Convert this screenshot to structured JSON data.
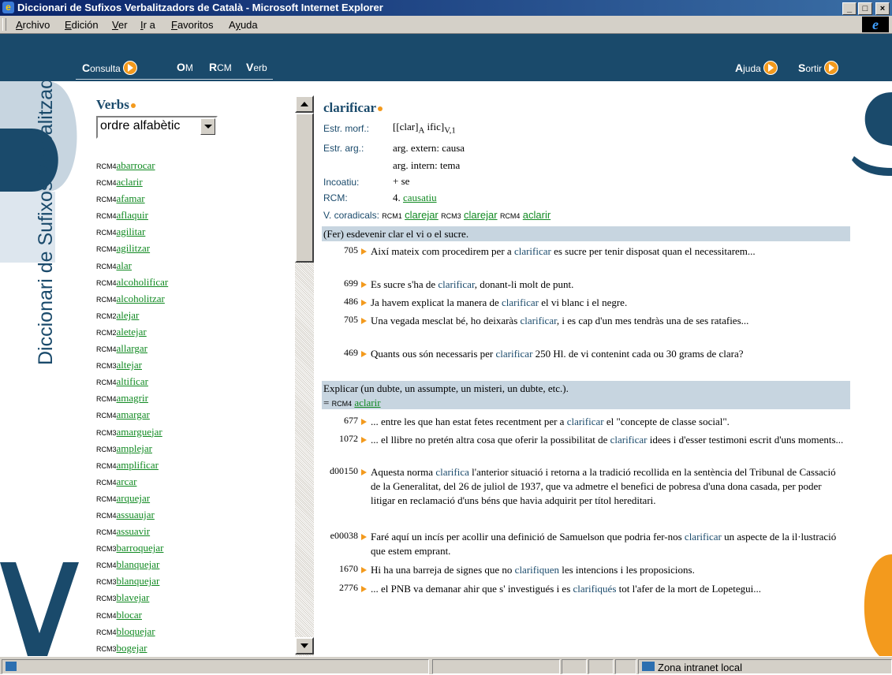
{
  "window": {
    "title": "Diccionari de Sufixos Verbalitzadors de Català - Microsoft Internet Explorer",
    "controls": {
      "minimize": "_",
      "maximize": "□",
      "close": "×"
    }
  },
  "menubar": {
    "items": [
      "Archivo",
      "Edición",
      "Ver",
      "Ir a",
      "Favoritos",
      "Ayuda"
    ]
  },
  "nav": {
    "consulta": {
      "initial": "C",
      "rest": "onsulta"
    },
    "om": {
      "initial": "O",
      "rest": "M"
    },
    "rcm": {
      "initial": "R",
      "rest": "CM"
    },
    "verb": {
      "initial": "V",
      "rest": "erb"
    },
    "ajuda": {
      "initial": "A",
      "rest": "juda"
    },
    "sortir": {
      "initial": "S",
      "rest": "ortir"
    }
  },
  "branding": {
    "vertical_title": "Diccionari de Sufixos Verbalitzadors del Català",
    "colors": {
      "navy": "#1a4a6b",
      "orange": "#f39a1d",
      "link_green": "#118a22",
      "band": "#c7d5e0"
    }
  },
  "sidebar": {
    "title": "Verbs",
    "order_select": "ordre alfabètic",
    "verbs": [
      {
        "rcm": "RCM4",
        "verb": "abarrocar"
      },
      {
        "rcm": "RCM4",
        "verb": "aclarir"
      },
      {
        "rcm": "RCM4",
        "verb": "afamar"
      },
      {
        "rcm": "RCM4",
        "verb": "aflaquir"
      },
      {
        "rcm": "RCM4",
        "verb": "agilitar"
      },
      {
        "rcm": "RCM4",
        "verb": "agilitzar"
      },
      {
        "rcm": "RCM4",
        "verb": "alar"
      },
      {
        "rcm": "RCM4",
        "verb": "alcoholificar"
      },
      {
        "rcm": "RCM4",
        "verb": "alcoholitzar"
      },
      {
        "rcm": "RCM2",
        "verb": "alejar"
      },
      {
        "rcm": "RCM2",
        "verb": "aletejar"
      },
      {
        "rcm": "RCM4",
        "verb": "allargar"
      },
      {
        "rcm": "RCM3",
        "verb": "altejar"
      },
      {
        "rcm": "RCM4",
        "verb": "altificar"
      },
      {
        "rcm": "RCM4",
        "verb": "amagrir"
      },
      {
        "rcm": "RCM4",
        "verb": "amargar"
      },
      {
        "rcm": "RCM3",
        "verb": "amarguejar"
      },
      {
        "rcm": "RCM3",
        "verb": "amplejar"
      },
      {
        "rcm": "RCM4",
        "verb": "amplificar"
      },
      {
        "rcm": "RCM4",
        "verb": "arcar"
      },
      {
        "rcm": "RCM4",
        "verb": "arquejar"
      },
      {
        "rcm": "RCM4",
        "verb": "assuaujar"
      },
      {
        "rcm": "RCM4",
        "verb": "assuavir"
      },
      {
        "rcm": "RCM3",
        "verb": "barroquejar"
      },
      {
        "rcm": "RCM4",
        "verb": "blanquejar"
      },
      {
        "rcm": "RCM3",
        "verb": "blanquejar"
      },
      {
        "rcm": "RCM3",
        "verb": "blavejar"
      },
      {
        "rcm": "RCM4",
        "verb": "blocar"
      },
      {
        "rcm": "RCM4",
        "verb": "bloquejar"
      },
      {
        "rcm": "RCM3",
        "verb": "bogejar"
      }
    ]
  },
  "entry": {
    "headword": "clarificar",
    "estr_morf_label": "Estr. morf.:",
    "estr_morf": {
      "open": "[[clar]",
      "sub_a": "A",
      "mid": " ific]",
      "sub_v": "V,1"
    },
    "estr_arg_label": "Estr. arg.:",
    "arg_extern": "arg. extern: causa",
    "arg_intern": "arg. intern: tema",
    "incoatiu_label": "Incoatiu:",
    "incoatiu": "+ se",
    "rcm_label": "RCM:",
    "rcm_num": "4.",
    "rcm_value": "causatiu",
    "coradicals_label": "V. coradicals:",
    "coradicals": [
      {
        "rcm": "RCM1",
        "verb": "clarejar"
      },
      {
        "rcm": "RCM3",
        "verb": "clarejar"
      },
      {
        "rcm": "RCM4",
        "verb": "aclarir"
      }
    ],
    "senses": [
      {
        "definition": "(Fer) esdevenir clar el vi o el sucre.",
        "examples": [
          {
            "num": "705",
            "pre": "Així mateix com procedirem per a ",
            "kw": "clarificar",
            "post": " es sucre per tenir disposat quan el necessitarem..."
          },
          {
            "num": "699",
            "pre": "Es sucre s'ha de ",
            "kw": "clarificar",
            "post": ", donant-li molt de punt."
          },
          {
            "num": "486",
            "pre": "Ja havem explicat la manera de ",
            "kw": "clarificar",
            "post": " el vi blanc i el negre."
          },
          {
            "num": "705",
            "pre": "Una vegada mesclat bé, ho deixaràs ",
            "kw": "clarificar",
            "post": ", i es cap d'un mes tendràs una de ses ratafies..."
          },
          {
            "num": "469",
            "pre": "Quants ous són necessaris per ",
            "kw": "clarificar",
            "post": " 250 Hl. de vi contenint cada ou 30 grams de clara?"
          }
        ]
      },
      {
        "definition": "Explicar (un dubte, un assumpte, un misteri, un dubte, etc.).",
        "eq_prefix": "=",
        "eq_rcm": "RCM4",
        "eq_verb": "aclarir",
        "examples": [
          {
            "num": "677",
            "pre": "... entre les que han estat fetes recentment per a ",
            "kw": "clarificar",
            "post": " el \"concepte de classe social\"."
          },
          {
            "num": "1072",
            "pre": "... el llibre no pretén altra cosa que oferir la possibilitat de ",
            "kw": "clarificar",
            "post": " idees i d'esser testimoni escrit d'uns moments..."
          },
          {
            "num": "d00150",
            "pre": "Aquesta norma ",
            "kw": "clarifica",
            "post": " l'anterior situació i retorna a la tradició recollida en la sentència del Tribunal de Cassació de la Generalitat, del 26 de juliol de 1937, que va admetre el benefici de pobresa d'una dona casada, per poder litigar en reclamació d'uns béns que havia adquirit per títol hereditari."
          },
          {
            "num": "e00038",
            "pre": "Faré aquí un incís per acollir una definició de Samuelson que podria fer-nos ",
            "kw": "clarificar",
            "post": " un aspecte de la il·lustració que estem emprant."
          },
          {
            "num": "1670",
            "pre": "Hi ha una barreja de signes que no ",
            "kw": "clarifiquen",
            "post": " les intencions i les proposicions."
          },
          {
            "num": "2776",
            "pre": "... el PNB va demanar ahir que s' investigués i es ",
            "kw": "clarifiqués",
            "post": " tot l'afer de la mort de Lopetegui..."
          }
        ]
      }
    ]
  },
  "statusbar": {
    "zone": "Zona intranet local"
  }
}
